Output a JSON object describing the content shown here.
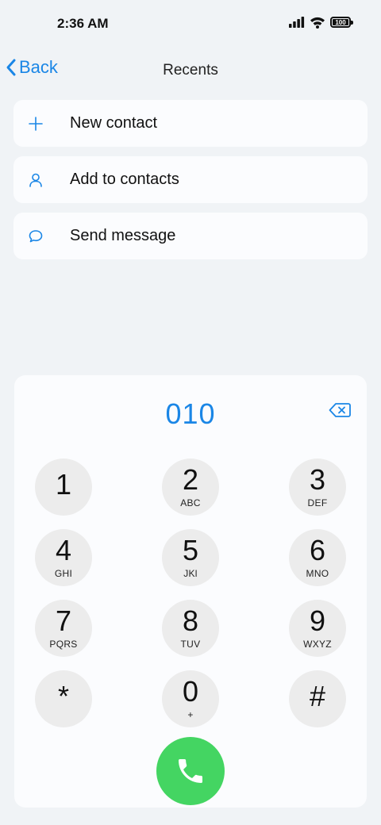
{
  "status_bar": {
    "time": "2:36 AM",
    "battery": "100",
    "battery_fraction": 1.0,
    "icons": [
      "signal-icon",
      "wifi-icon",
      "battery-icon"
    ]
  },
  "nav": {
    "back_label": "Back",
    "title": "Recents"
  },
  "actions": [
    {
      "label": "New contact",
      "icon": "plus-icon"
    },
    {
      "label": "Add to contacts",
      "icon": "person-icon"
    },
    {
      "label": "Send message",
      "icon": "message-bubble-icon"
    }
  ],
  "dialpad": {
    "display": "010",
    "keys": [
      {
        "digit": "1",
        "letters": ""
      },
      {
        "digit": "2",
        "letters": "ABC"
      },
      {
        "digit": "3",
        "letters": "DEF"
      },
      {
        "digit": "4",
        "letters": "GHI"
      },
      {
        "digit": "5",
        "letters": "JKl"
      },
      {
        "digit": "6",
        "letters": "MNO"
      },
      {
        "digit": "7",
        "letters": "PQRS"
      },
      {
        "digit": "8",
        "letters": "TUV"
      },
      {
        "digit": "9",
        "letters": "WXYZ"
      },
      {
        "digit": "*",
        "letters": ""
      },
      {
        "digit": "0",
        "letters": "+"
      },
      {
        "digit": "#",
        "letters": ""
      }
    ]
  },
  "colors": {
    "accent": "#1a86e6",
    "call_green": "#44d562",
    "background": "#f0f3f6",
    "card": "#fbfcfe",
    "key": "#ececec"
  }
}
